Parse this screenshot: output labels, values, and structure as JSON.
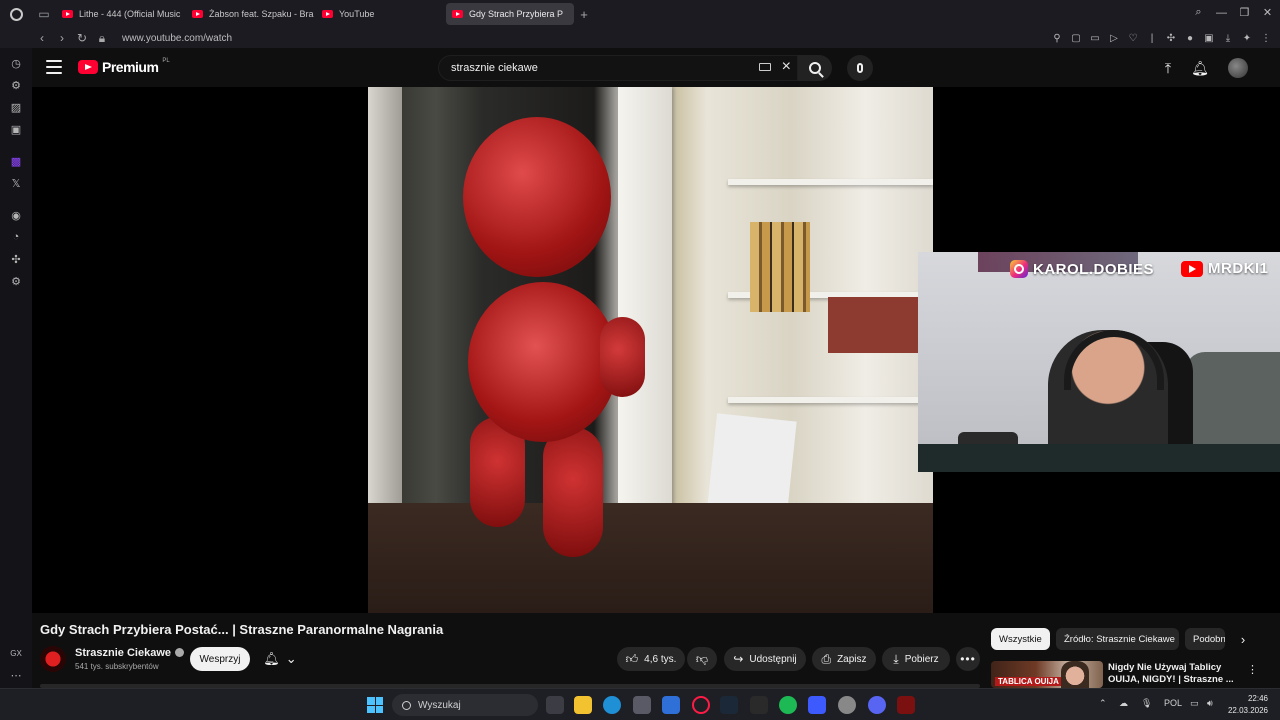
{
  "browser": {
    "tabs": [
      {
        "label": "Lithe - 444 (Official Music"
      },
      {
        "label": "Żabson feat. Szpaku - Bra"
      },
      {
        "label": "YouTube"
      },
      {
        "label": "Gdy Strach Przybiera P"
      }
    ],
    "url": "www.youtube.com/watch"
  },
  "youtube": {
    "logo_text": "Premium",
    "country_code": "PL",
    "search_value": "strasznie ciekawe",
    "video": {
      "title": "Gdy Strach Przybiera Postać... | Straszne Paranormalne Nagrania",
      "channel": "Strasznie Ciekawe",
      "subscribers": "541 tys. subskrybentów",
      "support_label": "Wesprzyj",
      "likes": "4,6 tys.",
      "share_label": "Udostępnij",
      "save_label": "Zapisz",
      "download_label": "Pobierz"
    },
    "overlay": {
      "instagram": "KAROL.DOBIES",
      "youtube": "MRDKI1"
    },
    "chips": [
      "Wszystkie",
      "Źródło: Strasznie Ciekawe",
      "Podobne"
    ],
    "recommendation": {
      "title": "Nigdy Nie Używaj Tablicy OUIJA, NIGDY! | Straszne ...",
      "thumb_text": "TABLICA OUIJA"
    }
  },
  "opera": {
    "sidebar_bottom_label": "GX"
  },
  "taskbar": {
    "search_placeholder": "Wyszukaj",
    "language": "POL",
    "time": "22:46",
    "date": "22.03.2026"
  },
  "colors": {
    "yt_red": "#ff0033",
    "background": "#0f0f0f",
    "twitch": "#9146ff",
    "windows_accent": "#4cc2ff"
  }
}
